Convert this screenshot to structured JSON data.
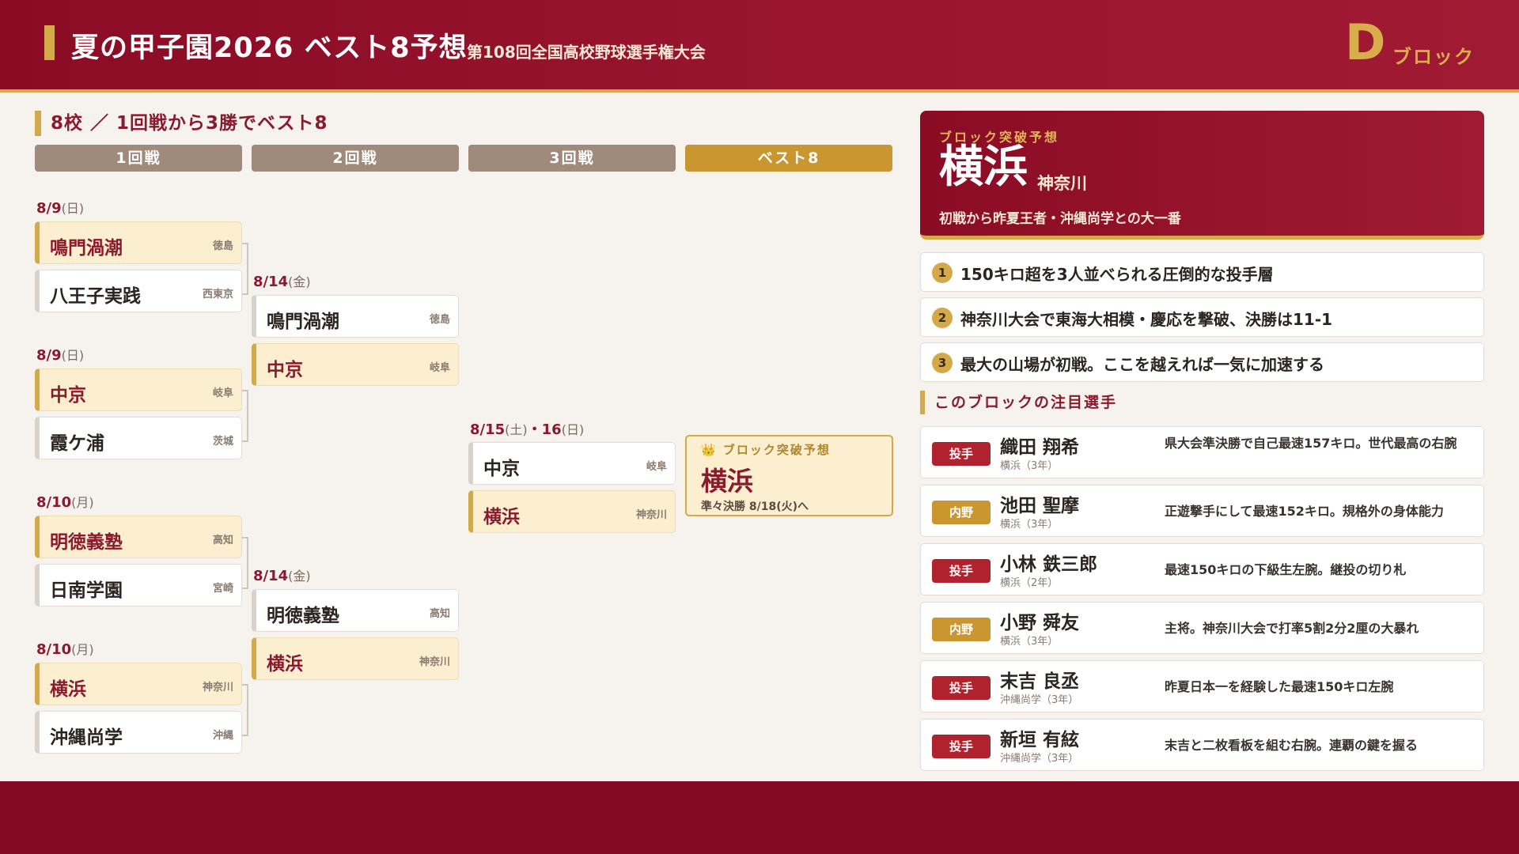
{
  "header": {
    "title": "夏の甲子園2026 ベスト8予想",
    "subtitle": "第108回全国高校野球選手権大会",
    "block_letter": "D",
    "block_word": "ブロック"
  },
  "bracket": {
    "heading": "8校 ／ 1回戦から3勝でベスト8",
    "rounds": [
      "1回戦",
      "2回戦",
      "3回戦",
      "ベスト8"
    ],
    "r1": [
      {
        "date": "8/9",
        "dow": "(日)",
        "teams": [
          {
            "name": "鳴門渦潮",
            "pref": "徳島"
          },
          {
            "name": "八王子実践",
            "pref": "西東京"
          }
        ]
      },
      {
        "date": "8/9",
        "dow": "(日)",
        "teams": [
          {
            "name": "中京",
            "pref": "岐阜"
          },
          {
            "name": "霞ケ浦",
            "pref": "茨城"
          }
        ]
      },
      {
        "date": "8/10",
        "dow": "(月)",
        "teams": [
          {
            "name": "明徳義塾",
            "pref": "高知"
          },
          {
            "name": "日南学園",
            "pref": "宮崎"
          }
        ]
      },
      {
        "date": "8/10",
        "dow": "(月)",
        "teams": [
          {
            "name": "横浜",
            "pref": "神奈川"
          },
          {
            "name": "沖縄尚学",
            "pref": "沖縄"
          }
        ]
      }
    ],
    "r2": [
      {
        "date": "8/14",
        "dow": "(金)",
        "teams": [
          {
            "name": "鳴門渦潮",
            "pref": "徳島"
          },
          {
            "name": "中京",
            "pref": "岐阜"
          }
        ]
      },
      {
        "date": "8/14",
        "dow": "(金)",
        "teams": [
          {
            "name": "明徳義塾",
            "pref": "高知"
          },
          {
            "name": "横浜",
            "pref": "神奈川"
          }
        ]
      }
    ],
    "r3": {
      "date_a": "8/15",
      "dow_a": "(土)",
      "sep": "・",
      "date_b": "16",
      "dow_b": "(日)",
      "teams": [
        {
          "name": "中京",
          "pref": "岐阜"
        },
        {
          "name": "横浜",
          "pref": "神奈川"
        }
      ]
    },
    "best8": {
      "icon": "👑",
      "label": "ブロック突破予想",
      "name": "横浜",
      "note": "準々決勝 8/18(火)へ"
    }
  },
  "prediction": {
    "label": "ブロック突破予想",
    "name": "横浜",
    "pref": "神奈川",
    "desc": "初戦から昨夏王者・沖縄尚学との大一番"
  },
  "points": [
    {
      "num": "1",
      "text": "150キロ超を3人並べられる圧倒的な投手層"
    },
    {
      "num": "2",
      "text": "神奈川大会で東海大相模・慶応を撃破、決勝は11-1"
    },
    {
      "num": "3",
      "text": "最大の山場が初戦。ここを越えれば一気に加速する"
    }
  ],
  "players_heading": "このブロックの注目選手",
  "players": [
    {
      "pos": "投手",
      "name": "織田 翔希",
      "school": "横浜（3年）",
      "desc": "県大会準決勝で自己最速157キロ。世代最高の右腕"
    },
    {
      "pos": "内野",
      "name": "池田 聖摩",
      "school": "横浜（3年）",
      "desc": "正遊撃手にして最速152キロ。規格外の身体能力"
    },
    {
      "pos": "投手",
      "name": "小林 鉄三郎",
      "school": "横浜（2年）",
      "desc": "最速150キロの下級生左腕。継投の切り札"
    },
    {
      "pos": "内野",
      "name": "小野 舜友",
      "school": "横浜（3年）",
      "desc": "主将。神奈川大会で打率5割2分2厘の大暴れ"
    },
    {
      "pos": "投手",
      "name": "末吉 良丞",
      "school": "沖縄尚学（3年）",
      "desc": "昨夏日本一を経験した最速150キロ左腕"
    },
    {
      "pos": "投手",
      "name": "新垣 有絃",
      "school": "沖縄尚学（3年）",
      "desc": "末吉と二枚看板を組む右腕。連覇の鍵を握る"
    }
  ]
}
